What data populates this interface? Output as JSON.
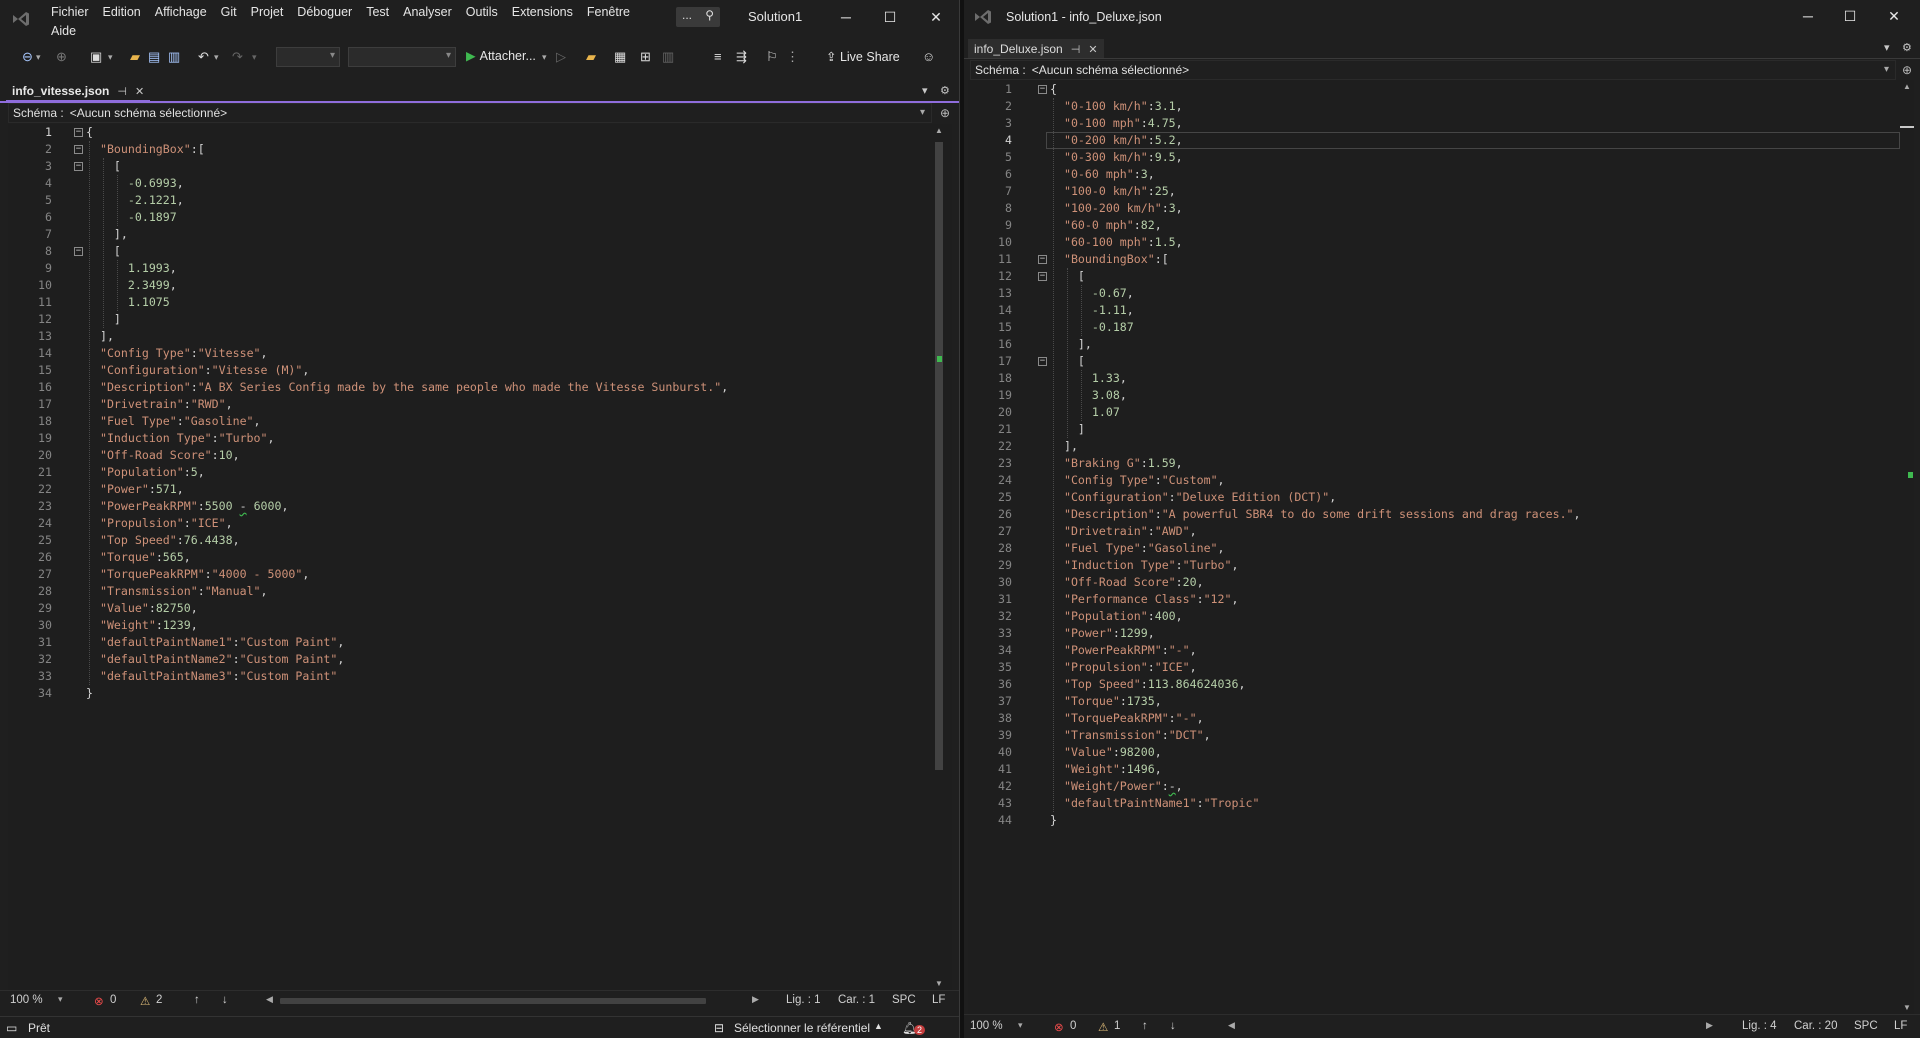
{
  "window1": {
    "menu": [
      "Fichier",
      "Edition",
      "Affichage",
      "Git",
      "Projet",
      "Déboguer",
      "Test",
      "Analyser",
      "Outils",
      "Extensions",
      "Fenêtre",
      "Aide"
    ],
    "search_dots": "...",
    "solution_title": "Solution1",
    "toolbar": {
      "attach_label": "Attacher...",
      "live_share_label": "Live Share"
    },
    "tab": {
      "label": "info_vitesse.json",
      "pin": "⊣",
      "close": "✕"
    },
    "schema": {
      "label": "Schéma :",
      "value": "<Aucun schéma sélectionné>"
    },
    "status": {
      "zoom": "100 %",
      "errors": "0",
      "warnings": "2",
      "line": "Lig. : 1",
      "char": "Car. : 1",
      "indent": "SPC",
      "eol": "LF"
    },
    "current_line": 1,
    "code": [
      [
        [
          "p",
          "{"
        ]
      ],
      [
        [
          "p",
          "  "
        ],
        [
          "k",
          "\"BoundingBox\""
        ],
        [
          "p",
          ":["
        ]
      ],
      [
        [
          "p",
          "    ["
        ]
      ],
      [
        [
          "p",
          "      "
        ],
        [
          "n",
          "-0.6993"
        ],
        [
          "p",
          ","
        ]
      ],
      [
        [
          "p",
          "      "
        ],
        [
          "n",
          "-2.1221"
        ],
        [
          "p",
          ","
        ]
      ],
      [
        [
          "p",
          "      "
        ],
        [
          "n",
          "-0.1897"
        ]
      ],
      [
        [
          "p",
          "    ],"
        ]
      ],
      [
        [
          "p",
          "    ["
        ]
      ],
      [
        [
          "p",
          "      "
        ],
        [
          "n",
          "1.1993"
        ],
        [
          "p",
          ","
        ]
      ],
      [
        [
          "p",
          "      "
        ],
        [
          "n",
          "2.3499"
        ],
        [
          "p",
          ","
        ]
      ],
      [
        [
          "p",
          "      "
        ],
        [
          "n",
          "1.1075"
        ]
      ],
      [
        [
          "p",
          "    ]"
        ]
      ],
      [
        [
          "p",
          "  ],"
        ]
      ],
      [
        [
          "p",
          "  "
        ],
        [
          "k",
          "\"Config Type\""
        ],
        [
          "p",
          ":"
        ],
        [
          "s",
          "\"Vitesse\""
        ],
        [
          "p",
          ","
        ]
      ],
      [
        [
          "p",
          "  "
        ],
        [
          "k",
          "\"Configuration\""
        ],
        [
          "p",
          ":"
        ],
        [
          "s",
          "\"Vitesse (M)\""
        ],
        [
          "p",
          ","
        ]
      ],
      [
        [
          "p",
          "  "
        ],
        [
          "k",
          "\"Description\""
        ],
        [
          "p",
          ":"
        ],
        [
          "s",
          "\"A BX Series Config made by the same people who made the Vitesse Sunburst.\""
        ],
        [
          "p",
          ","
        ]
      ],
      [
        [
          "p",
          "  "
        ],
        [
          "k",
          "\"Drivetrain\""
        ],
        [
          "p",
          ":"
        ],
        [
          "s",
          "\"RWD\""
        ],
        [
          "p",
          ","
        ]
      ],
      [
        [
          "p",
          "  "
        ],
        [
          "k",
          "\"Fuel Type\""
        ],
        [
          "p",
          ":"
        ],
        [
          "s",
          "\"Gasoline\""
        ],
        [
          "p",
          ","
        ]
      ],
      [
        [
          "p",
          "  "
        ],
        [
          "k",
          "\"Induction Type\""
        ],
        [
          "p",
          ":"
        ],
        [
          "s",
          "\"Turbo\""
        ],
        [
          "p",
          ","
        ]
      ],
      [
        [
          "p",
          "  "
        ],
        [
          "k",
          "\"Off-Road Score\""
        ],
        [
          "p",
          ":"
        ],
        [
          "n",
          "10"
        ],
        [
          "p",
          ","
        ]
      ],
      [
        [
          "p",
          "  "
        ],
        [
          "k",
          "\"Population\""
        ],
        [
          "p",
          ":"
        ],
        [
          "n",
          "5"
        ],
        [
          "p",
          ","
        ]
      ],
      [
        [
          "p",
          "  "
        ],
        [
          "k",
          "\"Power\""
        ],
        [
          "p",
          ":"
        ],
        [
          "n",
          "571"
        ],
        [
          "p",
          ","
        ]
      ],
      [
        [
          "p",
          "  "
        ],
        [
          "k",
          "\"PowerPeakRPM\""
        ],
        [
          "p",
          ":"
        ],
        [
          "n",
          "5500"
        ],
        [
          "p",
          " "
        ],
        [
          "q",
          "-"
        ],
        [
          "p",
          " "
        ],
        [
          "n",
          "6000"
        ],
        [
          "p",
          ","
        ]
      ],
      [
        [
          "p",
          "  "
        ],
        [
          "k",
          "\"Propulsion\""
        ],
        [
          "p",
          ":"
        ],
        [
          "s",
          "\"ICE\""
        ],
        [
          "p",
          ","
        ]
      ],
      [
        [
          "p",
          "  "
        ],
        [
          "k",
          "\"Top Speed\""
        ],
        [
          "p",
          ":"
        ],
        [
          "n",
          "76.4438"
        ],
        [
          "p",
          ","
        ]
      ],
      [
        [
          "p",
          "  "
        ],
        [
          "k",
          "\"Torque\""
        ],
        [
          "p",
          ":"
        ],
        [
          "n",
          "565"
        ],
        [
          "p",
          ","
        ]
      ],
      [
        [
          "p",
          "  "
        ],
        [
          "k",
          "\"TorquePeakRPM\""
        ],
        [
          "p",
          ":"
        ],
        [
          "s",
          "\"4000 - 5000\""
        ],
        [
          "p",
          ","
        ]
      ],
      [
        [
          "p",
          "  "
        ],
        [
          "k",
          "\"Transmission\""
        ],
        [
          "p",
          ":"
        ],
        [
          "s",
          "\"Manual\""
        ],
        [
          "p",
          ","
        ]
      ],
      [
        [
          "p",
          "  "
        ],
        [
          "k",
          "\"Value\""
        ],
        [
          "p",
          ":"
        ],
        [
          "n",
          "82750"
        ],
        [
          "p",
          ","
        ]
      ],
      [
        [
          "p",
          "  "
        ],
        [
          "k",
          "\"Weight\""
        ],
        [
          "p",
          ":"
        ],
        [
          "n",
          "1239"
        ],
        [
          "p",
          ","
        ]
      ],
      [
        [
          "p",
          "  "
        ],
        [
          "k",
          "\"defaultPaintName1\""
        ],
        [
          "p",
          ":"
        ],
        [
          "s",
          "\"Custom Paint\""
        ],
        [
          "p",
          ","
        ]
      ],
      [
        [
          "p",
          "  "
        ],
        [
          "k",
          "\"defaultPaintName2\""
        ],
        [
          "p",
          ":"
        ],
        [
          "s",
          "\"Custom Paint\""
        ],
        [
          "p",
          ","
        ]
      ],
      [
        [
          "p",
          "  "
        ],
        [
          "k",
          "\"defaultPaintName3\""
        ],
        [
          "p",
          ":"
        ],
        [
          "s",
          "\"Custom Paint\""
        ]
      ],
      [
        [
          "p",
          "}"
        ]
      ]
    ]
  },
  "window2": {
    "title": "Solution1 - info_Deluxe.json",
    "tab": {
      "label": "info_Deluxe.json",
      "pin": "⊣",
      "close": "✕"
    },
    "schema": {
      "label": "Schéma :",
      "value": "<Aucun schéma sélectionné>"
    },
    "status": {
      "zoom": "100 %",
      "errors": "0",
      "warnings": "1",
      "line": "Lig. : 4",
      "char": "Car. : 20",
      "indent": "SPC",
      "eol": "LF"
    },
    "current_line": 4,
    "code": [
      [
        [
          "p",
          "{"
        ]
      ],
      [
        [
          "p",
          "  "
        ],
        [
          "k",
          "\"0-100 km/h\""
        ],
        [
          "p",
          ":"
        ],
        [
          "n",
          "3.1"
        ],
        [
          "p",
          ","
        ]
      ],
      [
        [
          "p",
          "  "
        ],
        [
          "k",
          "\"0-100 mph\""
        ],
        [
          "p",
          ":"
        ],
        [
          "n",
          "4.75"
        ],
        [
          "p",
          ","
        ]
      ],
      [
        [
          "p",
          "  "
        ],
        [
          "k",
          "\"0-200 km/h\""
        ],
        [
          "p",
          ":"
        ],
        [
          "n",
          "5.2"
        ],
        [
          "p",
          ","
        ]
      ],
      [
        [
          "p",
          "  "
        ],
        [
          "k",
          "\"0-300 km/h\""
        ],
        [
          "p",
          ":"
        ],
        [
          "n",
          "9.5"
        ],
        [
          "p",
          ","
        ]
      ],
      [
        [
          "p",
          "  "
        ],
        [
          "k",
          "\"0-60 mph\""
        ],
        [
          "p",
          ":"
        ],
        [
          "n",
          "3"
        ],
        [
          "p",
          ","
        ]
      ],
      [
        [
          "p",
          "  "
        ],
        [
          "k",
          "\"100-0 km/h\""
        ],
        [
          "p",
          ":"
        ],
        [
          "n",
          "25"
        ],
        [
          "p",
          ","
        ]
      ],
      [
        [
          "p",
          "  "
        ],
        [
          "k",
          "\"100-200 km/h\""
        ],
        [
          "p",
          ":"
        ],
        [
          "n",
          "3"
        ],
        [
          "p",
          ","
        ]
      ],
      [
        [
          "p",
          "  "
        ],
        [
          "k",
          "\"60-0 mph\""
        ],
        [
          "p",
          ":"
        ],
        [
          "n",
          "82"
        ],
        [
          "p",
          ","
        ]
      ],
      [
        [
          "p",
          "  "
        ],
        [
          "k",
          "\"60-100 mph\""
        ],
        [
          "p",
          ":"
        ],
        [
          "n",
          "1.5"
        ],
        [
          "p",
          ","
        ]
      ],
      [
        [
          "p",
          "  "
        ],
        [
          "k",
          "\"BoundingBox\""
        ],
        [
          "p",
          ":["
        ]
      ],
      [
        [
          "p",
          "    ["
        ]
      ],
      [
        [
          "p",
          "      "
        ],
        [
          "n",
          "-0.67"
        ],
        [
          "p",
          ","
        ]
      ],
      [
        [
          "p",
          "      "
        ],
        [
          "n",
          "-1.11"
        ],
        [
          "p",
          ","
        ]
      ],
      [
        [
          "p",
          "      "
        ],
        [
          "n",
          "-0.187"
        ]
      ],
      [
        [
          "p",
          "    ],"
        ]
      ],
      [
        [
          "p",
          "    ["
        ]
      ],
      [
        [
          "p",
          "      "
        ],
        [
          "n",
          "1.33"
        ],
        [
          "p",
          ","
        ]
      ],
      [
        [
          "p",
          "      "
        ],
        [
          "n",
          "3.08"
        ],
        [
          "p",
          ","
        ]
      ],
      [
        [
          "p",
          "      "
        ],
        [
          "n",
          "1.07"
        ]
      ],
      [
        [
          "p",
          "    ]"
        ]
      ],
      [
        [
          "p",
          "  ],"
        ]
      ],
      [
        [
          "p",
          "  "
        ],
        [
          "k",
          "\"Braking G\""
        ],
        [
          "p",
          ":"
        ],
        [
          "n",
          "1.59"
        ],
        [
          "p",
          ","
        ]
      ],
      [
        [
          "p",
          "  "
        ],
        [
          "k",
          "\"Config Type\""
        ],
        [
          "p",
          ":"
        ],
        [
          "s",
          "\"Custom\""
        ],
        [
          "p",
          ","
        ]
      ],
      [
        [
          "p",
          "  "
        ],
        [
          "k",
          "\"Configuration\""
        ],
        [
          "p",
          ":"
        ],
        [
          "s",
          "\"Deluxe Edition (DCT)\""
        ],
        [
          "p",
          ","
        ]
      ],
      [
        [
          "p",
          "  "
        ],
        [
          "k",
          "\"Description\""
        ],
        [
          "p",
          ":"
        ],
        [
          "s",
          "\"A powerful SBR4 to do some drift sessions and drag races.\""
        ],
        [
          "p",
          ","
        ]
      ],
      [
        [
          "p",
          "  "
        ],
        [
          "k",
          "\"Drivetrain\""
        ],
        [
          "p",
          ":"
        ],
        [
          "s",
          "\"AWD\""
        ],
        [
          "p",
          ","
        ]
      ],
      [
        [
          "p",
          "  "
        ],
        [
          "k",
          "\"Fuel Type\""
        ],
        [
          "p",
          ":"
        ],
        [
          "s",
          "\"Gasoline\""
        ],
        [
          "p",
          ","
        ]
      ],
      [
        [
          "p",
          "  "
        ],
        [
          "k",
          "\"Induction Type\""
        ],
        [
          "p",
          ":"
        ],
        [
          "s",
          "\"Turbo\""
        ],
        [
          "p",
          ","
        ]
      ],
      [
        [
          "p",
          "  "
        ],
        [
          "k",
          "\"Off-Road Score\""
        ],
        [
          "p",
          ":"
        ],
        [
          "n",
          "20"
        ],
        [
          "p",
          ","
        ]
      ],
      [
        [
          "p",
          "  "
        ],
        [
          "k",
          "\"Performance Class\""
        ],
        [
          "p",
          ":"
        ],
        [
          "s",
          "\"12\""
        ],
        [
          "p",
          ","
        ]
      ],
      [
        [
          "p",
          "  "
        ],
        [
          "k",
          "\"Population\""
        ],
        [
          "p",
          ":"
        ],
        [
          "n",
          "400"
        ],
        [
          "p",
          ","
        ]
      ],
      [
        [
          "p",
          "  "
        ],
        [
          "k",
          "\"Power\""
        ],
        [
          "p",
          ":"
        ],
        [
          "n",
          "1299"
        ],
        [
          "p",
          ","
        ]
      ],
      [
        [
          "p",
          "  "
        ],
        [
          "k",
          "\"PowerPeakRPM\""
        ],
        [
          "p",
          ":"
        ],
        [
          "s",
          "\"-\""
        ],
        [
          "p",
          ","
        ]
      ],
      [
        [
          "p",
          "  "
        ],
        [
          "k",
          "\"Propulsion\""
        ],
        [
          "p",
          ":"
        ],
        [
          "s",
          "\"ICE\""
        ],
        [
          "p",
          ","
        ]
      ],
      [
        [
          "p",
          "  "
        ],
        [
          "k",
          "\"Top Speed\""
        ],
        [
          "p",
          ":"
        ],
        [
          "n",
          "113.864624036"
        ],
        [
          "p",
          ","
        ]
      ],
      [
        [
          "p",
          "  "
        ],
        [
          "k",
          "\"Torque\""
        ],
        [
          "p",
          ":"
        ],
        [
          "n",
          "1735"
        ],
        [
          "p",
          ","
        ]
      ],
      [
        [
          "p",
          "  "
        ],
        [
          "k",
          "\"TorquePeakRPM\""
        ],
        [
          "p",
          ":"
        ],
        [
          "s",
          "\"-\""
        ],
        [
          "p",
          ","
        ]
      ],
      [
        [
          "p",
          "  "
        ],
        [
          "k",
          "\"Transmission\""
        ],
        [
          "p",
          ":"
        ],
        [
          "s",
          "\"DCT\""
        ],
        [
          "p",
          ","
        ]
      ],
      [
        [
          "p",
          "  "
        ],
        [
          "k",
          "\"Value\""
        ],
        [
          "p",
          ":"
        ],
        [
          "n",
          "98200"
        ],
        [
          "p",
          ","
        ]
      ],
      [
        [
          "p",
          "  "
        ],
        [
          "k",
          "\"Weight\""
        ],
        [
          "p",
          ":"
        ],
        [
          "n",
          "1496"
        ],
        [
          "p",
          ","
        ]
      ],
      [
        [
          "p",
          "  "
        ],
        [
          "k",
          "\"Weight/Power\""
        ],
        [
          "p",
          ":"
        ],
        [
          "q",
          "-"
        ],
        [
          "p",
          ","
        ]
      ],
      [
        [
          "p",
          "  "
        ],
        [
          "k",
          "\"defaultPaintName1\""
        ],
        [
          "p",
          ":"
        ],
        [
          "s",
          "\"Tropic\""
        ]
      ],
      [
        [
          "p",
          "}"
        ]
      ]
    ]
  },
  "statusbar": {
    "ready": "Prêt",
    "repo": "Sélectionner le référentiel",
    "notifications": "2"
  },
  "colors": {
    "accent": "#8f6ddc",
    "key": "#ce9178",
    "number": "#b5cea8",
    "error": "#f14c4c",
    "warning": "#e5c07b",
    "ok": "#3fb950"
  }
}
